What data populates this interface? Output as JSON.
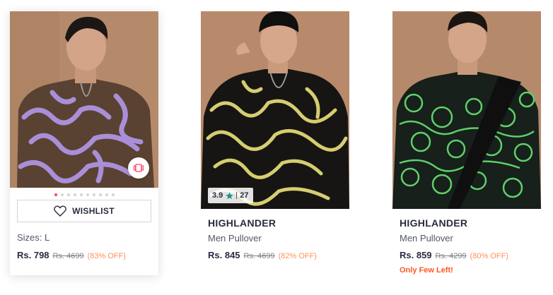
{
  "products": [
    {
      "wishlist_label": "WISHLIST",
      "sizes": "Sizes: L",
      "price": "Rs. 798",
      "mrp": "Rs. 4699",
      "discount": "(83% OFF)",
      "image_dots": 10,
      "active_dot": 0,
      "colors": {
        "bg": "#b58a6b",
        "sweater": "#5a4232",
        "pattern": "#a98fd8"
      }
    },
    {
      "rating": "3.9",
      "rating_count": "27",
      "brand": "HIGHLANDER",
      "title": "Men Pullover",
      "price": "Rs. 845",
      "mrp": "Rs. 4699",
      "discount": "(82% OFF)",
      "colors": {
        "bg": "#b8896a",
        "sweater": "#161513",
        "pattern": "#d6cd6f"
      }
    },
    {
      "brand": "HIGHLANDER",
      "title": "Men Pullover",
      "price": "Rs. 859",
      "mrp": "Rs. 4299",
      "discount": "(80% OFF)",
      "stock_note": "Only Few Left!",
      "colors": {
        "bg": "#b58a6b",
        "sweater": "#17201a",
        "pattern": "#5fcf6b"
      }
    }
  ],
  "icons": {
    "wishlist": "heart-icon",
    "similar": "similar-products-icon",
    "rating": "star-icon"
  },
  "accent": {
    "rating_star": "#14958f",
    "discount": "#ff905a",
    "stock": "#ff5722",
    "active_dot": "#ff3f6c"
  }
}
